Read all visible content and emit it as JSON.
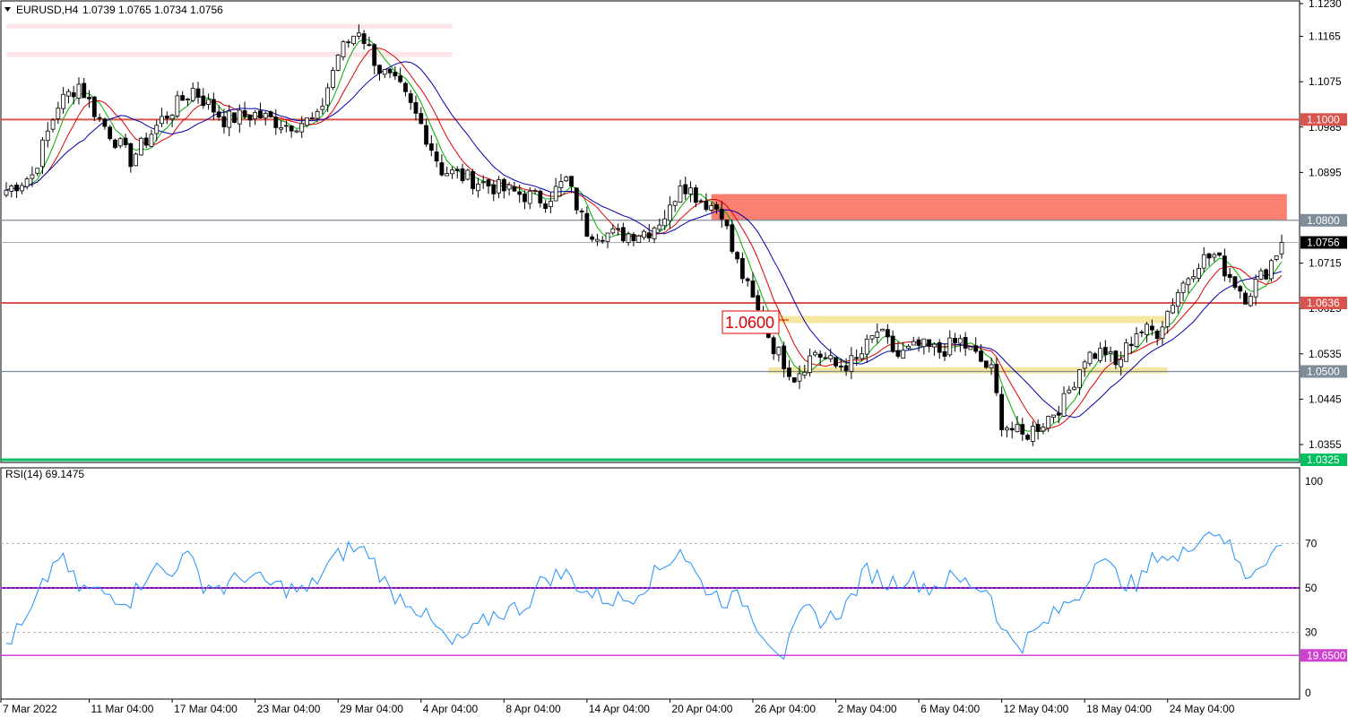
{
  "header": {
    "symbol": "EURUSD,H4",
    "ohlc": "1.0739 1.0765 1.0734 1.0756",
    "menu_icon": "triangle-down-icon"
  },
  "rsi_header": "RSI(14) 69.1475",
  "colors": {
    "bull": "#ffffff",
    "bear": "#000000",
    "ma_fast": "#00b000",
    "ma_mid": "#e00000",
    "ma_slow": "#0000b0",
    "level_red": "#d9534f",
    "level_gray": "#7f8c9a",
    "level_green": "#00c060",
    "zone_red": "#fa8072",
    "zone_yellow": "#f5e7a0",
    "zone_pink": "#fde5ea",
    "rsi_line": "#1e90ff",
    "rsi_mid": "#8a00b8",
    "rsi_low": "#d040d0",
    "current_price_bg": "#000000"
  },
  "chart_data": [
    {
      "type": "candlestick",
      "title": "EURUSD,H4",
      "ylim": [
        1.0325,
        1.123
      ],
      "y_ticks": [
        "1.1230",
        "1.1165",
        "1.1075",
        "1.0985",
        "1.0895",
        "1.0715",
        "1.0625",
        "1.0535",
        "1.0445",
        "1.0355"
      ],
      "x_ticks": [
        "7 Mar 2022",
        "11 Mar 04:00",
        "17 Mar 04:00",
        "23 Mar 04:00",
        "29 Mar 04:00",
        "4 Apr 04:00",
        "8 Apr 04:00",
        "14 Apr 04:00",
        "20 Apr 04:00",
        "26 Apr 04:00",
        "2 May 04:00",
        "6 May 04:00",
        "12 May 04:00",
        "18 May 04:00",
        "24 May 04:00"
      ],
      "anchors": [
        [
          0,
          1.086
        ],
        [
          5,
          1.089
        ],
        [
          10,
          1.103
        ],
        [
          14,
          1.107
        ],
        [
          18,
          1.1
        ],
        [
          24,
          1.092
        ],
        [
          30,
          1.1
        ],
        [
          36,
          1.106
        ],
        [
          42,
          1.1
        ],
        [
          48,
          1.101
        ],
        [
          54,
          1.099
        ],
        [
          60,
          1.1
        ],
        [
          64,
          1.113
        ],
        [
          68,
          1.118
        ],
        [
          72,
          1.11
        ],
        [
          76,
          1.106
        ],
        [
          80,
          1.099
        ],
        [
          84,
          1.09
        ],
        [
          90,
          1.088
        ],
        [
          96,
          1.086
        ],
        [
          104,
          1.084
        ],
        [
          108,
          1.088
        ],
        [
          112,
          1.078
        ],
        [
          118,
          1.077
        ],
        [
          124,
          1.078
        ],
        [
          128,
          1.082
        ],
        [
          130,
          1.088
        ],
        [
          134,
          1.084
        ],
        [
          138,
          1.082
        ],
        [
          140,
          1.074
        ],
        [
          144,
          1.064
        ],
        [
          148,
          1.055
        ],
        [
          152,
          1.049
        ],
        [
          156,
          1.054
        ],
        [
          160,
          1.051
        ],
        [
          164,
          1.052
        ],
        [
          168,
          1.058
        ],
        [
          172,
          1.053
        ],
        [
          176,
          1.055
        ],
        [
          180,
          1.054
        ],
        [
          184,
          1.056
        ],
        [
          190,
          1.05
        ],
        [
          192,
          1.04
        ],
        [
          196,
          1.037
        ],
        [
          200,
          1.04
        ],
        [
          204,
          1.044
        ],
        [
          208,
          1.053
        ],
        [
          212,
          1.054
        ],
        [
          214,
          1.051
        ],
        [
          218,
          1.058
        ],
        [
          222,
          1.058
        ],
        [
          226,
          1.066
        ],
        [
          230,
          1.072
        ],
        [
          233,
          1.073
        ],
        [
          236,
          1.069
        ],
        [
          239,
          1.065
        ],
        [
          243,
          1.07
        ],
        [
          246,
          1.0756
        ]
      ],
      "levels": [
        {
          "value": 1.1,
          "label": "1.1000",
          "style": "red"
        },
        {
          "value": 1.08,
          "label": "1.0800",
          "style": "gray"
        },
        {
          "value": 1.0636,
          "label": "1.0636",
          "style": "red"
        },
        {
          "value": 1.05,
          "label": "1.0500",
          "style": "gray"
        },
        {
          "value": 1.0325,
          "label": "1.0325",
          "style": "green"
        }
      ],
      "current_price": {
        "value": 1.0756,
        "label": "1.0756"
      },
      "zones": [
        {
          "color": "red",
          "y_from": 1.08,
          "y_to": 1.0852,
          "x_from": 136,
          "x_to": 247
        },
        {
          "color": "yellow",
          "y_from": 1.0596,
          "y_to": 1.061,
          "x_from": 149,
          "x_to": 224
        },
        {
          "color": "yellow",
          "y_from": 1.0496,
          "y_to": 1.0508,
          "x_from": 147,
          "x_to": 224
        },
        {
          "color": "pink",
          "y_from": 1.118,
          "y_to": 1.119,
          "x_from": 0,
          "x_to": 86
        },
        {
          "color": "pink",
          "y_from": 1.1124,
          "y_to": 1.1134,
          "x_from": 0,
          "x_to": 86
        }
      ],
      "annotation": {
        "text": "1.0600",
        "value": 1.06
      }
    },
    {
      "type": "line",
      "title": "RSI(14) 69.1475",
      "ylim": [
        0,
        100
      ],
      "y_ticks": [
        "100",
        "70",
        "50",
        "30",
        "0"
      ],
      "levels": [
        {
          "value": 70,
          "style": "dash"
        },
        {
          "value": 50,
          "style": "mid"
        },
        {
          "value": 30,
          "style": "dash"
        },
        {
          "value": 19.65,
          "label": "19.6500",
          "style": "low"
        }
      ],
      "anchors": [
        [
          0,
          25
        ],
        [
          4,
          35
        ],
        [
          8,
          55
        ],
        [
          10,
          65
        ],
        [
          14,
          50
        ],
        [
          18,
          48
        ],
        [
          24,
          45
        ],
        [
          28,
          60
        ],
        [
          32,
          55
        ],
        [
          34,
          68
        ],
        [
          38,
          52
        ],
        [
          42,
          50
        ],
        [
          46,
          56
        ],
        [
          50,
          52
        ],
        [
          54,
          50
        ],
        [
          58,
          48
        ],
        [
          62,
          60
        ],
        [
          66,
          68
        ],
        [
          70,
          66
        ],
        [
          74,
          48
        ],
        [
          78,
          44
        ],
        [
          82,
          34
        ],
        [
          86,
          24
        ],
        [
          90,
          30
        ],
        [
          94,
          38
        ],
        [
          100,
          42
        ],
        [
          104,
          55
        ],
        [
          108,
          56
        ],
        [
          112,
          48
        ],
        [
          116,
          45
        ],
        [
          120,
          45
        ],
        [
          126,
          58
        ],
        [
          130,
          68
        ],
        [
          134,
          52
        ],
        [
          138,
          45
        ],
        [
          142,
          45
        ],
        [
          146,
          30
        ],
        [
          150,
          20
        ],
        [
          154,
          40
        ],
        [
          158,
          35
        ],
        [
          162,
          42
        ],
        [
          166,
          58
        ],
        [
          170,
          52
        ],
        [
          174,
          55
        ],
        [
          178,
          50
        ],
        [
          182,
          54
        ],
        [
          186,
          52
        ],
        [
          190,
          48
        ],
        [
          192,
          30
        ],
        [
          196,
          25
        ],
        [
          200,
          33
        ],
        [
          204,
          42
        ],
        [
          208,
          50
        ],
        [
          210,
          65
        ],
        [
          214,
          56
        ],
        [
          218,
          50
        ],
        [
          222,
          66
        ],
        [
          226,
          62
        ],
        [
          230,
          74
        ],
        [
          234,
          76
        ],
        [
          236,
          68
        ],
        [
          239,
          55
        ],
        [
          242,
          62
        ],
        [
          246,
          69.15
        ]
      ]
    }
  ]
}
